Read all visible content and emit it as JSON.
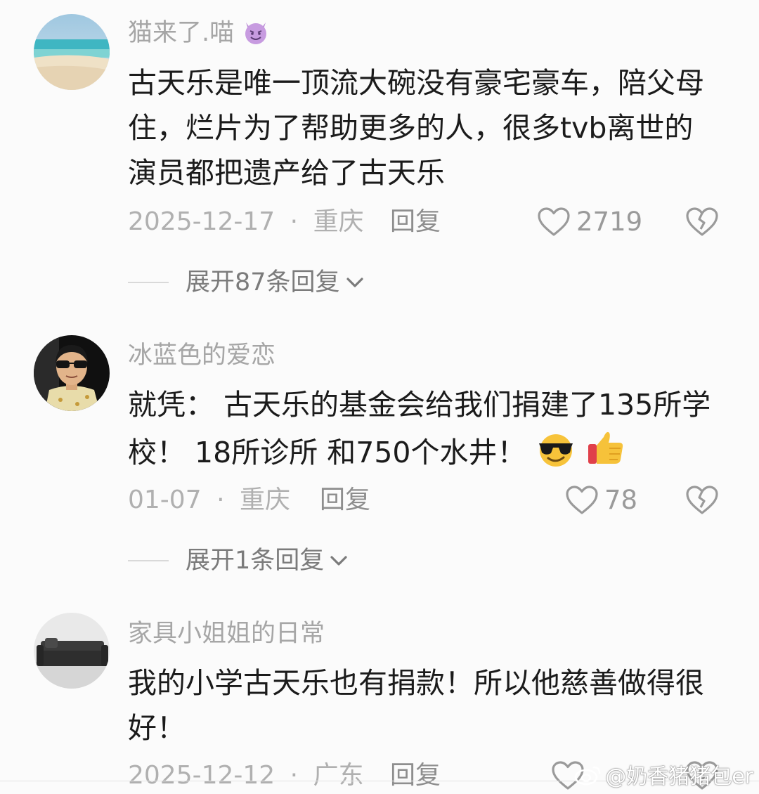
{
  "comments": [
    {
      "username": "猫来了.喵",
      "username_emoji": "smiling-imp-emoji",
      "text": "古天乐是唯一顶流大碗没有豪宅豪车，陪父母住，烂片为了帮助更多的人，很多tvb离世的演员都把遗产给了古天乐",
      "date": "2025-12-17",
      "location": "重庆",
      "reply_label": "回复",
      "likes": "2719",
      "expand_label": "展开87条回复"
    },
    {
      "username": "冰蓝色的爱恋",
      "text": "就凭： 古天乐的基金会给我们捐建了135所学校！ 18所诊所 和750个水井！",
      "text_emojis": [
        "sunglasses-emoji",
        "thumbs-up-emoji"
      ],
      "date": "01-07",
      "location": "重庆",
      "reply_label": "回复",
      "likes": "78",
      "expand_label": "展开1条回复"
    },
    {
      "username": "家具小姐姐的日常",
      "text": "我的小学古天乐也有捐款！所以他慈善做得很好！",
      "date": "2025-12-12",
      "location": "广东",
      "reply_label": "回复"
    }
  ],
  "meta_separator": "·",
  "watermark": {
    "text": "@奶香猪猪包er",
    "icon": "weibo-logo-icon"
  },
  "colors": {
    "background": "#fbfbfb",
    "username": "#a6a6a6",
    "text": "#1b1b1b",
    "meta": "#b0b0b0"
  }
}
